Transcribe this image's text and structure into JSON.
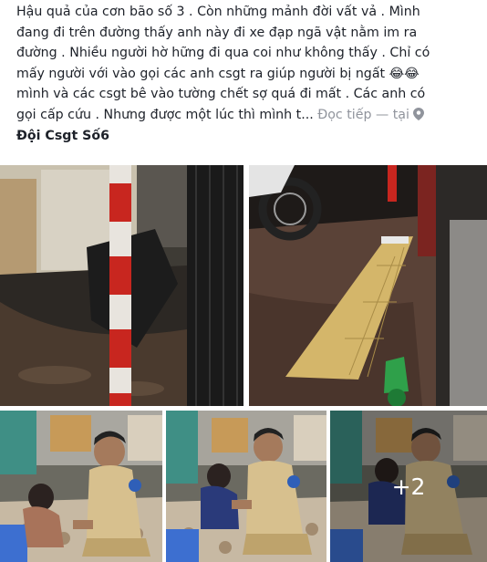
{
  "post": {
    "lines": [
      "Hậu quả của cơn bão số 3 . Còn những mảnh đời vất vả . Mình",
      "đang đi trên đường thấy anh này đi xe đạp ngã vật nằm im ra",
      "đường . Nhiều người hờ hững đi qua coi như không thấy . Chỉ có",
      "mấy người với vào gọi các anh csgt ra giúp người bị ngất",
      "mình và các csgt bê vào tường chết sợ quá đi mất . Các anh có",
      "gọi cấp cứu . Nhưng được một lúc thì mình t..."
    ],
    "emoji": "😂😂",
    "see_more": "Đọc tiếp",
    "at_label": "— tại",
    "place": "Đội Csgt Số6",
    "place_icon": "location-pin-icon"
  },
  "photos": {
    "more_count": "+2",
    "count": 5
  },
  "colors": {
    "text": "#1d2129",
    "muted": "#90949c",
    "background": "#ffffff"
  }
}
